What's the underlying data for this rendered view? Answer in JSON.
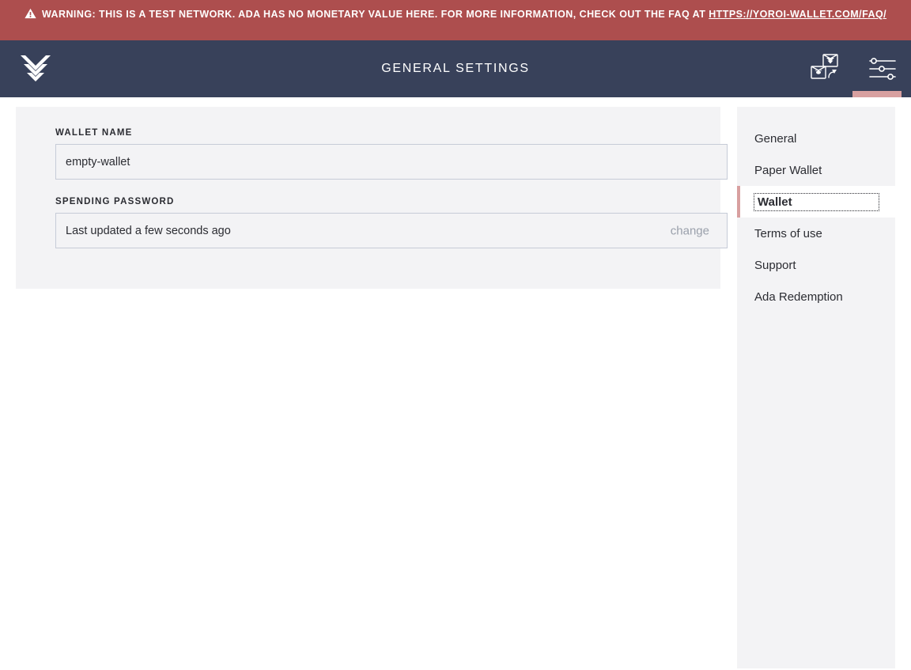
{
  "warning": {
    "icon": "warning-triangle-icon",
    "text_before": "WARNING: THIS IS A TEST NETWORK. ADA HAS NO MONETARY VALUE HERE. FOR MORE INFORMATION, CHECK OUT THE FAQ AT ",
    "link_text": "HTTPS://YOROI-WALLET.COM/FAQ/",
    "bg_color": "#ad4e4e",
    "text_color": "#ffffff"
  },
  "topbar": {
    "logo_name": "yoroi-logo",
    "title": "GENERAL SETTINGS",
    "bg_color": "#38415a",
    "actions": [
      {
        "name": "wallet-switch-icon",
        "label": "Switch wallet"
      },
      {
        "name": "settings-sliders-icon",
        "label": "Settings",
        "active": true
      }
    ],
    "active_indicator_color": "#d8a0a0"
  },
  "settings_form": {
    "wallet_name_label": "WALLET NAME",
    "wallet_name_value": "empty-wallet",
    "wallet_name_placeholder": "",
    "spending_password_label": "SPENDING PASSWORD",
    "spending_password_status": "Last updated a few seconds ago",
    "change_label": "change",
    "panel_bg": "#f3f3f5"
  },
  "settings_menu": {
    "items": [
      {
        "label": "General",
        "active": false
      },
      {
        "label": "Paper Wallet",
        "active": false
      },
      {
        "label": "Wallet",
        "active": true
      },
      {
        "label": "Terms of use",
        "active": false
      },
      {
        "label": "Support",
        "active": false
      },
      {
        "label": "Ada Redemption",
        "active": false
      }
    ],
    "active_accent_color": "#d8a0a0",
    "panel_bg": "#f3f3f5"
  }
}
